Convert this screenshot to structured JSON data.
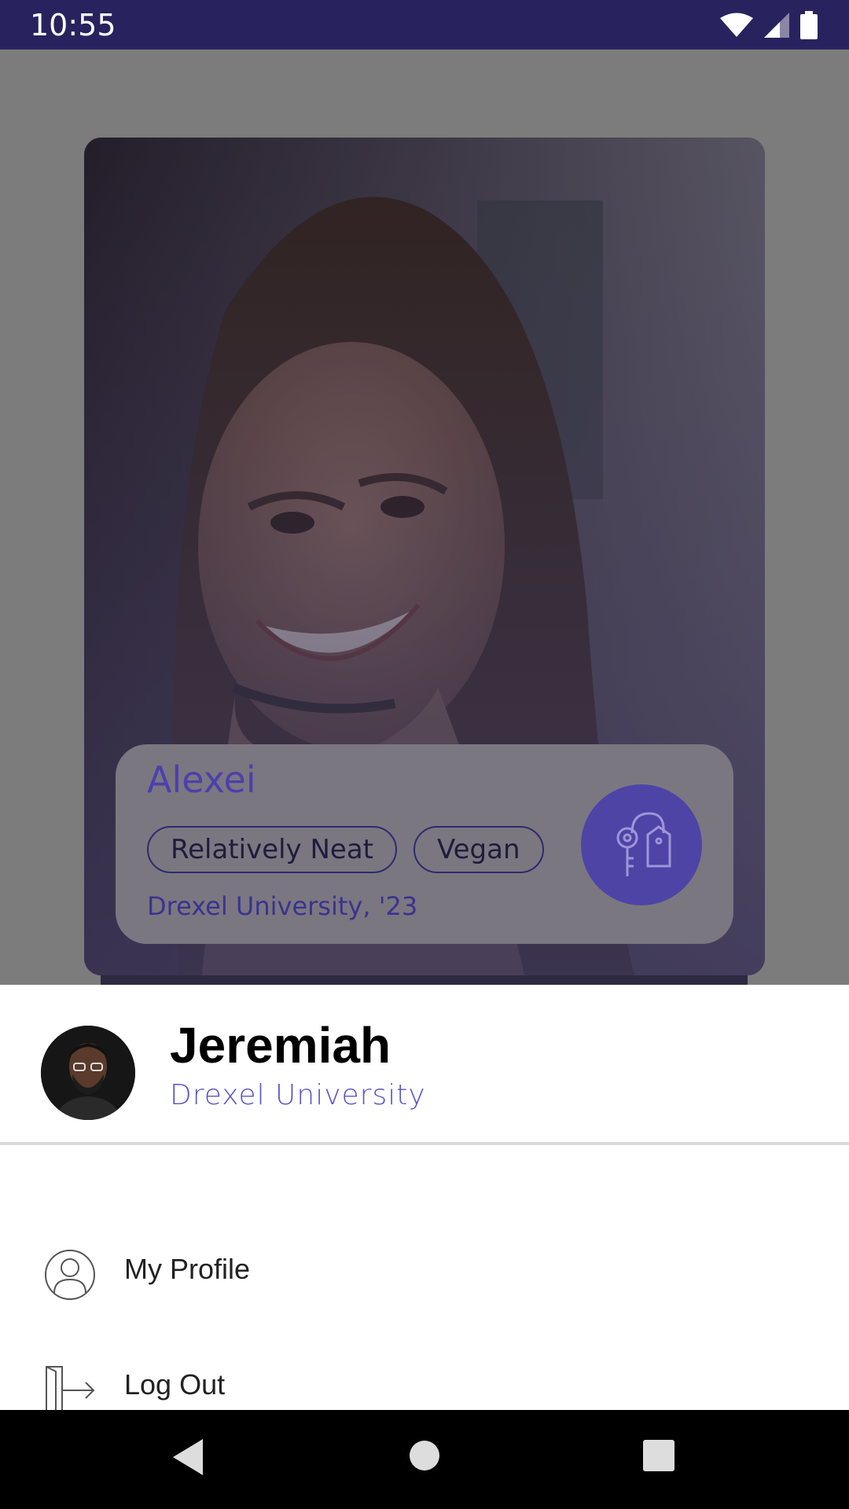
{
  "status_bar": {
    "time": "10:55"
  },
  "card": {
    "name": "Alexei",
    "tags": [
      "Relatively Neat",
      "Vegan"
    ],
    "school": "Drexel University, '23"
  },
  "drawer": {
    "user_name": "Jeremiah",
    "user_school": "Drexel University",
    "menu": [
      {
        "label": "My Profile",
        "icon": "profile-icon"
      },
      {
        "label": "Log Out",
        "icon": "logout-icon"
      }
    ]
  },
  "colors": {
    "status_bar": "#28235e",
    "accent": "#5b52c8",
    "key_button": "#4d44a6"
  }
}
